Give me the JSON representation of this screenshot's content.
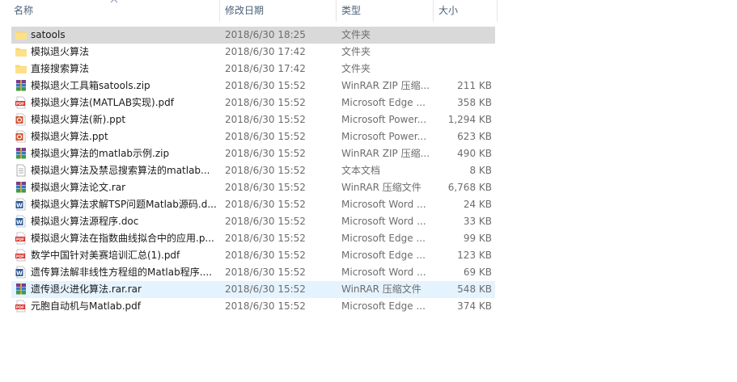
{
  "columns": {
    "name": "名称",
    "date": "修改日期",
    "type": "类型",
    "size": "大小"
  },
  "files": [
    {
      "name": "satools",
      "date": "2018/6/30 18:25",
      "type": "文件夹",
      "size": "",
      "icon": "folder-icon",
      "state": "selected"
    },
    {
      "name": "模拟退火算法",
      "date": "2018/6/30 17:42",
      "type": "文件夹",
      "size": "",
      "icon": "folder-icon",
      "state": ""
    },
    {
      "name": "直接搜索算法",
      "date": "2018/6/30 17:42",
      "type": "文件夹",
      "size": "",
      "icon": "folder-icon",
      "state": ""
    },
    {
      "name": "模拟退火工具箱satools.zip",
      "date": "2018/6/30 15:52",
      "type": "WinRAR ZIP 压缩...",
      "size": "211 KB",
      "icon": "winrar-icon",
      "state": ""
    },
    {
      "name": "模拟退火算法(MATLAB实现).pdf",
      "date": "2018/6/30 15:52",
      "type": "Microsoft Edge ...",
      "size": "358 KB",
      "icon": "pdf-icon",
      "state": ""
    },
    {
      "name": "模拟退火算法(新).ppt",
      "date": "2018/6/30 15:52",
      "type": "Microsoft Power...",
      "size": "1,294 KB",
      "icon": "powerpoint-icon",
      "state": ""
    },
    {
      "name": "模拟退火算法.ppt",
      "date": "2018/6/30 15:52",
      "type": "Microsoft Power...",
      "size": "623 KB",
      "icon": "powerpoint-icon",
      "state": ""
    },
    {
      "name": "模拟退火算法的matlab示例.zip",
      "date": "2018/6/30 15:52",
      "type": "WinRAR ZIP 压缩...",
      "size": "490 KB",
      "icon": "winrar-icon",
      "state": ""
    },
    {
      "name": "模拟退火算法及禁忌搜索算法的matlab...",
      "date": "2018/6/30 15:52",
      "type": "文本文档",
      "size": "8 KB",
      "icon": "text-document-icon",
      "state": ""
    },
    {
      "name": "模拟退火算法论文.rar",
      "date": "2018/6/30 15:52",
      "type": "WinRAR 压缩文件",
      "size": "6,768 KB",
      "icon": "winrar-icon",
      "state": ""
    },
    {
      "name": "模拟退火算法求解TSP问题Matlab源码.d...",
      "date": "2018/6/30 15:52",
      "type": "Microsoft Word ...",
      "size": "24 KB",
      "icon": "word-icon",
      "state": ""
    },
    {
      "name": "模拟退火算法源程序.doc",
      "date": "2018/6/30 15:52",
      "type": "Microsoft Word ...",
      "size": "33 KB",
      "icon": "word-icon",
      "state": ""
    },
    {
      "name": "模拟退火算法在指数曲线拟合中的应用.p...",
      "date": "2018/6/30 15:52",
      "type": "Microsoft Edge ...",
      "size": "99 KB",
      "icon": "pdf-icon",
      "state": ""
    },
    {
      "name": "数学中国针对美赛培训汇总(1).pdf",
      "date": "2018/6/30 15:52",
      "type": "Microsoft Edge ...",
      "size": "123 KB",
      "icon": "pdf-icon",
      "state": ""
    },
    {
      "name": "遗传算法解非线性方程组的Matlab程序....",
      "date": "2018/6/30 15:52",
      "type": "Microsoft Word ...",
      "size": "69 KB",
      "icon": "word-icon",
      "state": ""
    },
    {
      "name": "遗传退火进化算法.rar.rar",
      "date": "2018/6/30 15:52",
      "type": "WinRAR 压缩文件",
      "size": "548 KB",
      "icon": "winrar-icon",
      "state": "hover"
    },
    {
      "name": "元胞自动机与Matlab.pdf",
      "date": "2018/6/30 15:52",
      "type": "Microsoft Edge ...",
      "size": "374 KB",
      "icon": "pdf-icon",
      "state": ""
    }
  ]
}
